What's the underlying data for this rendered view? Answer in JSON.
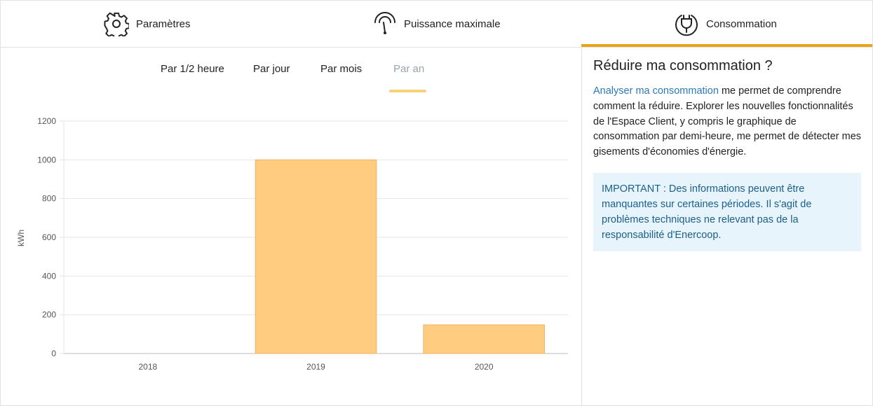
{
  "top_tabs": [
    {
      "label": "Paramètres",
      "icon": "gear-icon"
    },
    {
      "label": "Puissance maximale",
      "icon": "power-gauge-icon"
    },
    {
      "label": "Consommation",
      "icon": "plug-icon",
      "active": true
    }
  ],
  "sub_tabs": [
    {
      "label": "Par 1/2 heure"
    },
    {
      "label": "Par jour"
    },
    {
      "label": "Par mois"
    },
    {
      "label": "Par an",
      "active": true
    }
  ],
  "colors": {
    "accent": "#e8a317",
    "bar_fill": "#ffcc80",
    "bar_stroke": "#f5b060",
    "link": "#2a7ab8",
    "note_bg": "#e8f4fc"
  },
  "chart_data": {
    "type": "bar",
    "categories": [
      "2018",
      "2019",
      "2020"
    ],
    "values": [
      0,
      1000,
      148
    ],
    "ylabel": "kWh",
    "ylim": [
      0,
      1200
    ],
    "yticks": [
      0,
      200,
      400,
      600,
      800,
      1000,
      1200
    ],
    "grid": true
  },
  "aside": {
    "title": "Réduire ma consommation ?",
    "link_text": "Analyser ma consommation",
    "body_text": " me permet de comprendre comment la réduire. Explorer les nouvelles fonctionnalités de l'Espace Client, y compris le graphique de consommation par demi-heure, me permet de détecter mes gisements d'économies d'énergie.",
    "note": "IMPORTANT : Des informations peuvent être manquantes sur certaines périodes. Il s'agit de problèmes techniques ne relevant pas de la responsabilité d'Enercoop."
  }
}
